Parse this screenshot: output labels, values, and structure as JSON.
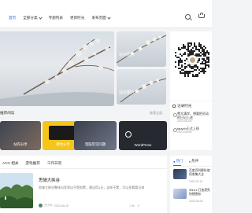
{
  "header": {
    "nav": [
      {
        "label": "首页",
        "active": true,
        "dropdown": false
      },
      {
        "label": "全部分类",
        "active": false,
        "dropdown": true
      },
      {
        "label": "专题列表",
        "active": false,
        "dropdown": false
      },
      {
        "label": "更新时光",
        "active": false,
        "dropdown": false
      },
      {
        "label": "发布页面",
        "active": false,
        "dropdown": true
      }
    ],
    "search_icon": "search-icon",
    "bag_icon": "bag-icon"
  },
  "hero": {
    "main_title": "",
    "side": [
      {
        "caption": "站点图片"
      },
      {
        "caption": "站点图片"
      }
    ]
  },
  "sidebar": {
    "qr_icon": "wechat-qr-code",
    "log": {
      "title": "记录时光",
      "items": [
        {
          "text": "雪大满岸，想要把灵动的日记上述",
          "date": "2023-08-08"
        },
        {
          "text": "tapych正式上线",
          "date": "2023-08-08"
        }
      ]
    },
    "hot": {
      "tabs": [
        {
          "label": "热门",
          "active": true
        },
        {
          "label": "热评",
          "active": false
        }
      ],
      "posts": [
        {
          "title": "百度百科解析使用收集大全",
          "date": "2023-02-10"
        },
        {
          "title": "Win11 打造漂亮快捷图标",
          "date": "2023-08-08"
        }
      ]
    }
  },
  "featured": {
    "heading": "推荐阅读",
    "more": "查看全部",
    "cards": [
      {
        "label": "站内分享"
      },
      {
        "label": "教你分享"
      },
      {
        "label": "电脑常见问题"
      },
      {
        "label": "WordPress"
      }
    ]
  },
  "list": {
    "tabs": [
      "ACG 相关",
      "游戏推荐",
      "工作日常"
    ],
    "post": {
      "title": "思施大峡谷",
      "excerpt": "思施大峡谷整体出发到达不是很累，建议用1天，这样不累，可以多看看沿海",
      "author": "元小木",
      "date": "2023-08-10",
      "stats": [
        "1.3k",
        "0"
      ]
    }
  },
  "colors": {
    "accent": "#2a6fdb",
    "bg": "#f3f4f6"
  }
}
